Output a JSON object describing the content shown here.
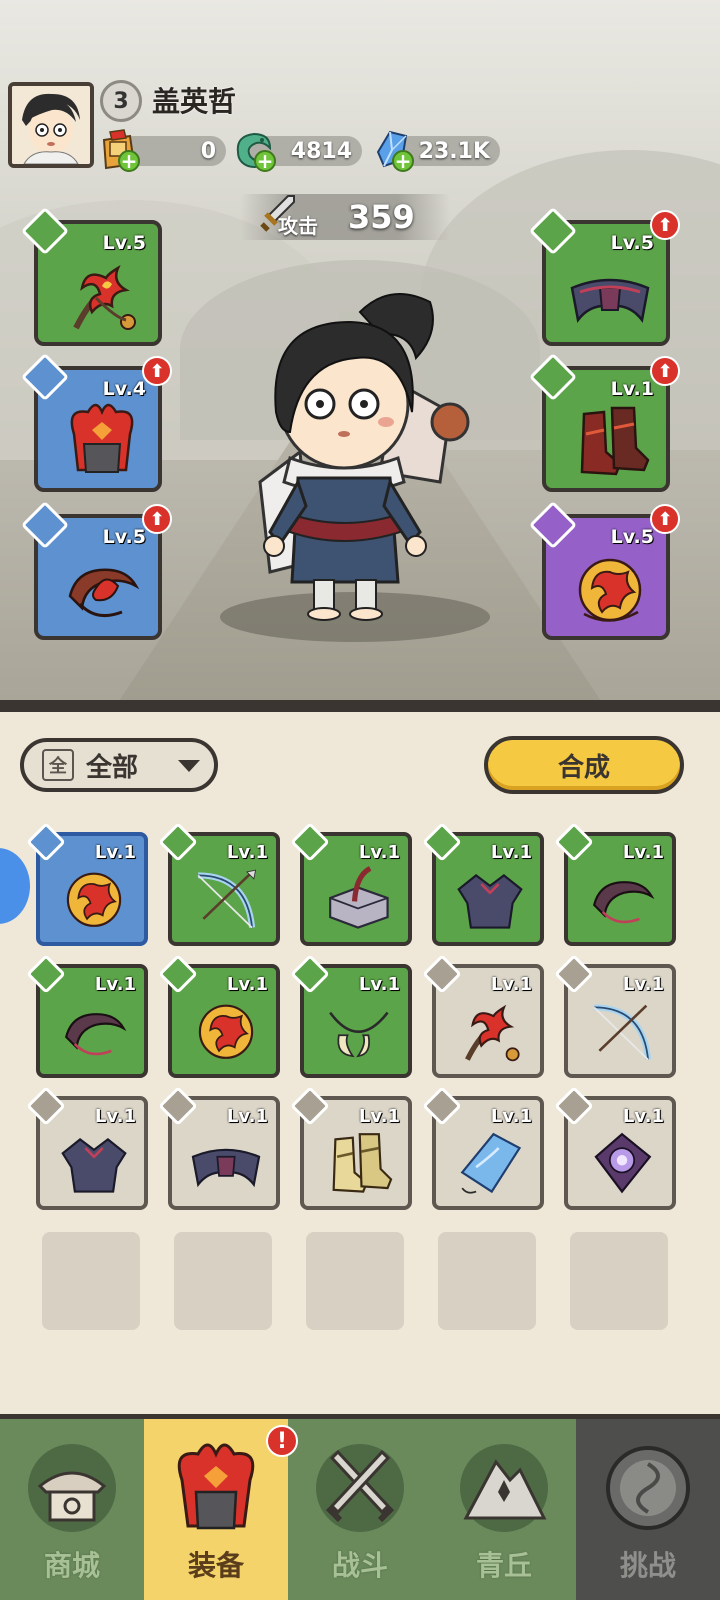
{
  "player": {
    "level": "3",
    "name": "盖英哲"
  },
  "currencies": [
    {
      "icon": "scroll-bag-icon",
      "value": "0"
    },
    {
      "icon": "jade-dragon-icon",
      "value": "4814"
    },
    {
      "icon": "crystal-icon",
      "value": "23.1K"
    }
  ],
  "attack": {
    "label": "攻击",
    "value": "359"
  },
  "equipped": {
    "left": [
      {
        "type": "weapon",
        "rarity": "green",
        "level": "Lv.5",
        "upgrade": false,
        "item": "flower-flail"
      },
      {
        "type": "armor",
        "rarity": "blue",
        "level": "Lv.4",
        "upgrade": true,
        "item": "flame-helmet"
      },
      {
        "type": "ring",
        "rarity": "blue",
        "level": "Lv.5",
        "upgrade": true,
        "item": "flame-bracelet"
      }
    ],
    "right": [
      {
        "type": "belt",
        "rarity": "green",
        "level": "Lv.5",
        "upgrade": true,
        "item": "shadow-belt"
      },
      {
        "type": "boots",
        "rarity": "green",
        "level": "Lv.1",
        "upgrade": true,
        "item": "flame-boots"
      },
      {
        "type": "amulet",
        "rarity": "purple",
        "level": "Lv.5",
        "upgrade": true,
        "item": "flame-orb"
      }
    ]
  },
  "inventory_controls": {
    "filter_icon_text": "全",
    "filter_label": "全部",
    "craft_label": "合成"
  },
  "inventory": [
    {
      "type": "amulet",
      "rarity": "blue",
      "level": "Lv.1",
      "item": "flame-orb"
    },
    {
      "type": "weapon",
      "rarity": "green",
      "level": "Lv.1",
      "item": "ice-bow"
    },
    {
      "type": "weapon",
      "rarity": "green",
      "level": "Lv.1",
      "item": "stone-hammer"
    },
    {
      "type": "armor",
      "rarity": "green",
      "level": "Lv.1",
      "item": "shadow-armor"
    },
    {
      "type": "ring",
      "rarity": "green",
      "level": "Lv.1",
      "item": "shadow-bracelet"
    },
    {
      "type": "ring",
      "rarity": "green",
      "level": "Lv.1",
      "item": "shadow-bracelet"
    },
    {
      "type": "amulet",
      "rarity": "green",
      "level": "Lv.1",
      "item": "flame-orb"
    },
    {
      "type": "amulet",
      "rarity": "green",
      "level": "Lv.1",
      "item": "fang-necklace"
    },
    {
      "type": "weapon",
      "rarity": "gray",
      "level": "Lv.1",
      "item": "flower-flail"
    },
    {
      "type": "weapon",
      "rarity": "gray",
      "level": "Lv.1",
      "item": "ice-bow"
    },
    {
      "type": "armor",
      "rarity": "gray",
      "level": "Lv.1",
      "item": "shadow-armor"
    },
    {
      "type": "belt",
      "rarity": "gray",
      "level": "Lv.1",
      "item": "shadow-belt"
    },
    {
      "type": "boots",
      "rarity": "gray",
      "level": "Lv.1",
      "item": "gold-boots"
    },
    {
      "type": "amulet",
      "rarity": "gray",
      "level": "Lv.1",
      "item": "ice-crystal"
    },
    {
      "type": "amulet",
      "rarity": "gray",
      "level": "Lv.1",
      "item": "void-orb"
    }
  ],
  "empty_slots": 5,
  "nav": [
    {
      "label": "商城",
      "icon": "shop-icon",
      "state": "normal"
    },
    {
      "label": "装备",
      "icon": "helmet-icon",
      "state": "active",
      "alert": "!"
    },
    {
      "label": "战斗",
      "icon": "crossed-swords-icon",
      "state": "normal"
    },
    {
      "label": "青丘",
      "icon": "mountain-icon",
      "state": "normal"
    },
    {
      "label": "挑战",
      "icon": "portal-icon",
      "state": "locked"
    }
  ],
  "colors": {
    "green": "#5ca449",
    "blue": "#5d91cf",
    "purple": "#9560c7",
    "gray": "#dcd6c8",
    "craft": "#f6c943",
    "nav_active": "#f4d36a",
    "alert": "#d8322a"
  }
}
